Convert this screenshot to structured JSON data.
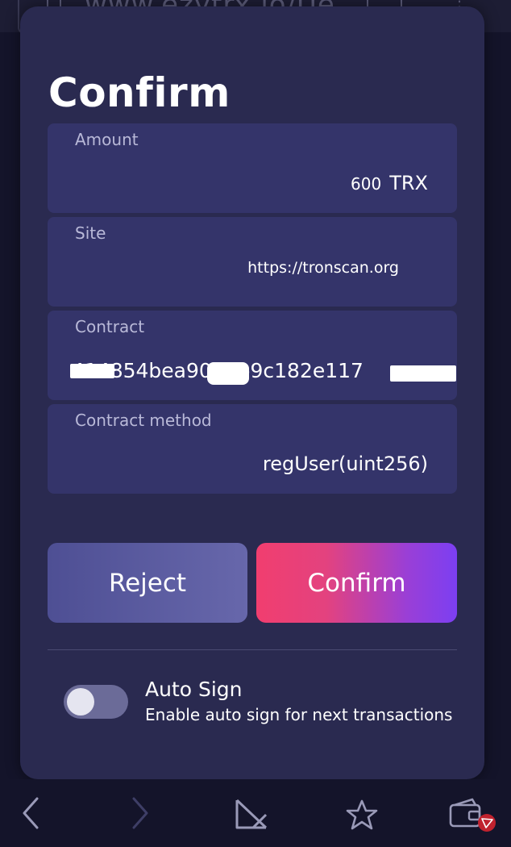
{
  "browser": {
    "url_text": "www.ezytrx.io/Ue"
  },
  "dialog": {
    "title": "Confirm",
    "fields": {
      "amount": {
        "label": "Amount",
        "value": "600",
        "unit": "TRX"
      },
      "site": {
        "label": "Site",
        "value": "https://tronscan.org"
      },
      "contract": {
        "label": "Contract",
        "value": "414854bea90  .9b9c182e117"
      },
      "method": {
        "label": "Contract method",
        "value": "regUser(uint256)"
      }
    },
    "buttons": {
      "reject": "Reject",
      "confirm": "Confirm"
    },
    "auto_sign": {
      "title": "Auto Sign",
      "description": "Enable auto sign for next transactions",
      "enabled": false
    }
  },
  "bottom_nav": {
    "items": [
      "back-icon",
      "forward-icon",
      "split-view-icon",
      "bookmark-star-icon",
      "wallet-icon"
    ]
  },
  "colors": {
    "panel": "#2a2a50",
    "field": "#34346a",
    "confirm_gradient_start": "#f13e6f",
    "confirm_gradient_end": "#7c3ff2",
    "reject": "#5a5ba0"
  }
}
